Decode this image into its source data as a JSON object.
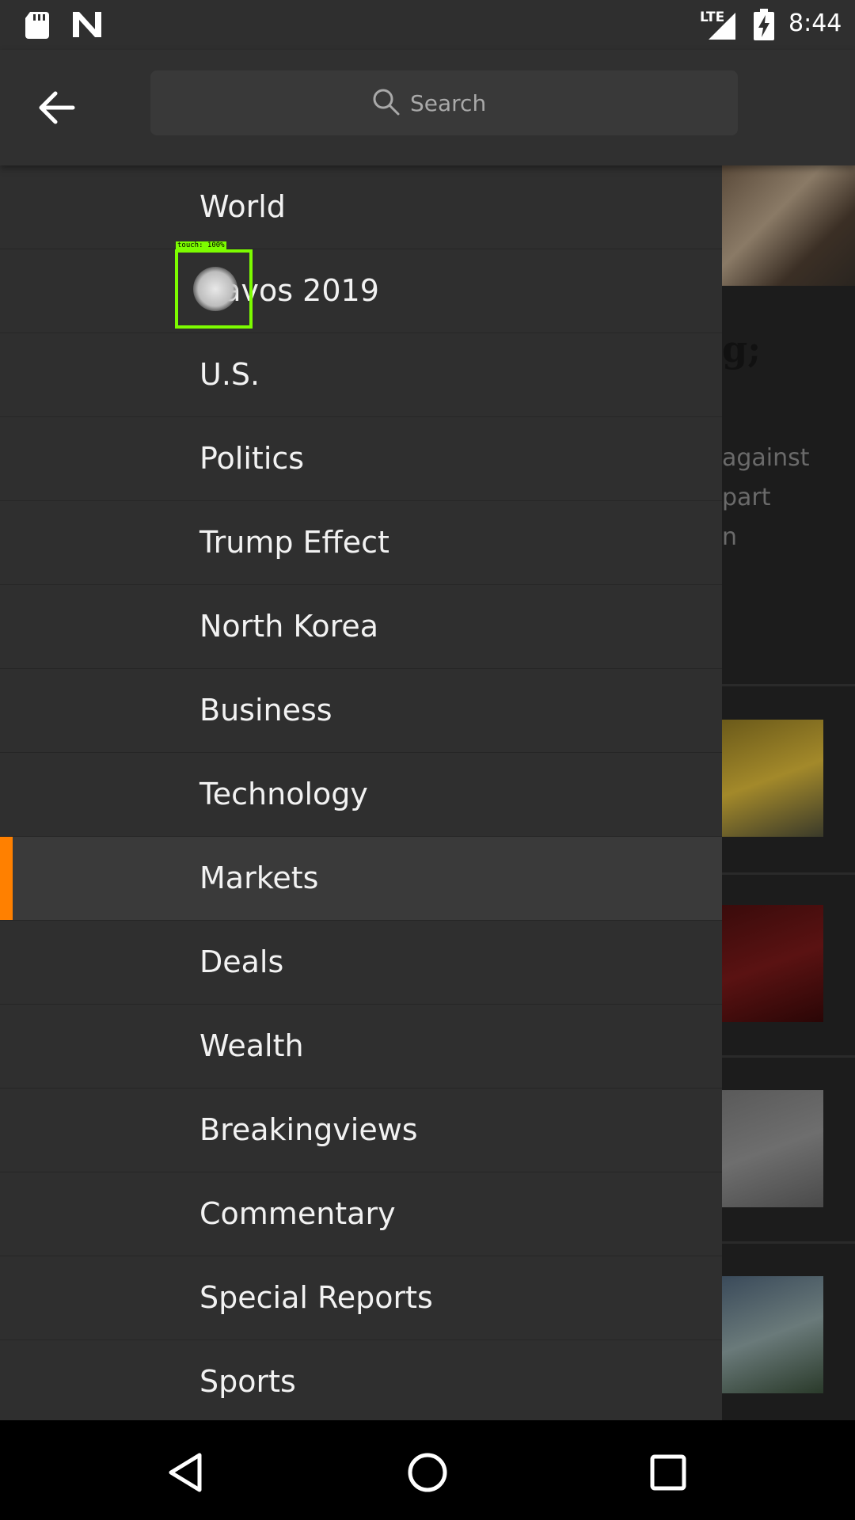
{
  "status_bar": {
    "network": "LTE",
    "time": "8:44"
  },
  "header": {
    "search_placeholder": "Search"
  },
  "menu": {
    "items": [
      {
        "label": "World"
      },
      {
        "label": "Davos 2019"
      },
      {
        "label": "U.S."
      },
      {
        "label": "Politics"
      },
      {
        "label": "Trump Effect"
      },
      {
        "label": "North Korea"
      },
      {
        "label": "Business"
      },
      {
        "label": "Technology"
      },
      {
        "label": "Markets",
        "active": true
      },
      {
        "label": "Deals"
      },
      {
        "label": "Wealth"
      },
      {
        "label": "Breakingviews"
      },
      {
        "label": "Commentary"
      },
      {
        "label": "Special Reports"
      },
      {
        "label": "Sports"
      }
    ],
    "active_color": "#ff8000"
  },
  "background_content": {
    "headline_fragment": "g;",
    "desc_fragment": "against\npart\nn"
  },
  "touch_overlay": {
    "label": "touch: 100%"
  }
}
